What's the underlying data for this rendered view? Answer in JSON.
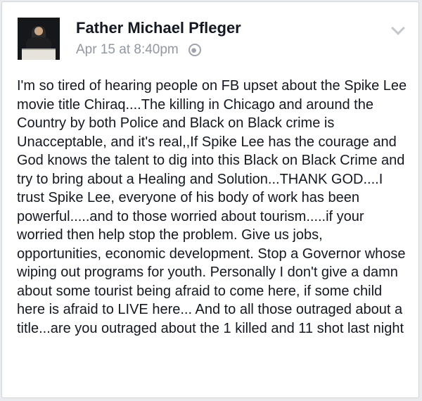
{
  "post": {
    "author": "Father Michael Pfleger",
    "timestamp": "Apr 15 at 8:40pm",
    "privacy_icon": "globe-icon",
    "menu_icon": "chevron-down-icon",
    "text": "I'm so tired of hearing people on FB upset about the Spike Lee movie title Chiraq....The killing in Chicago and around the Country by both Police and Black on Black crime is Unacceptable, and it's real,,If Spike Lee has the courage and God knows the talent to dig into this Black on Black Crime and try to bring about a Healing and Solution...THANK GOD....I trust Spike Lee, everyone of his body of work has been powerful.....and to those worried about tourism.....if your worried then help stop the problem. Give us jobs, opportunities, economic development. Stop a Governor whose wiping out programs for youth. Personally I don't give a damn about some tourist being afraid to come here, if some child here is afraid to LIVE here... And to all those outraged about a title...are you outraged about the 1 killed and 11 shot last night"
  }
}
